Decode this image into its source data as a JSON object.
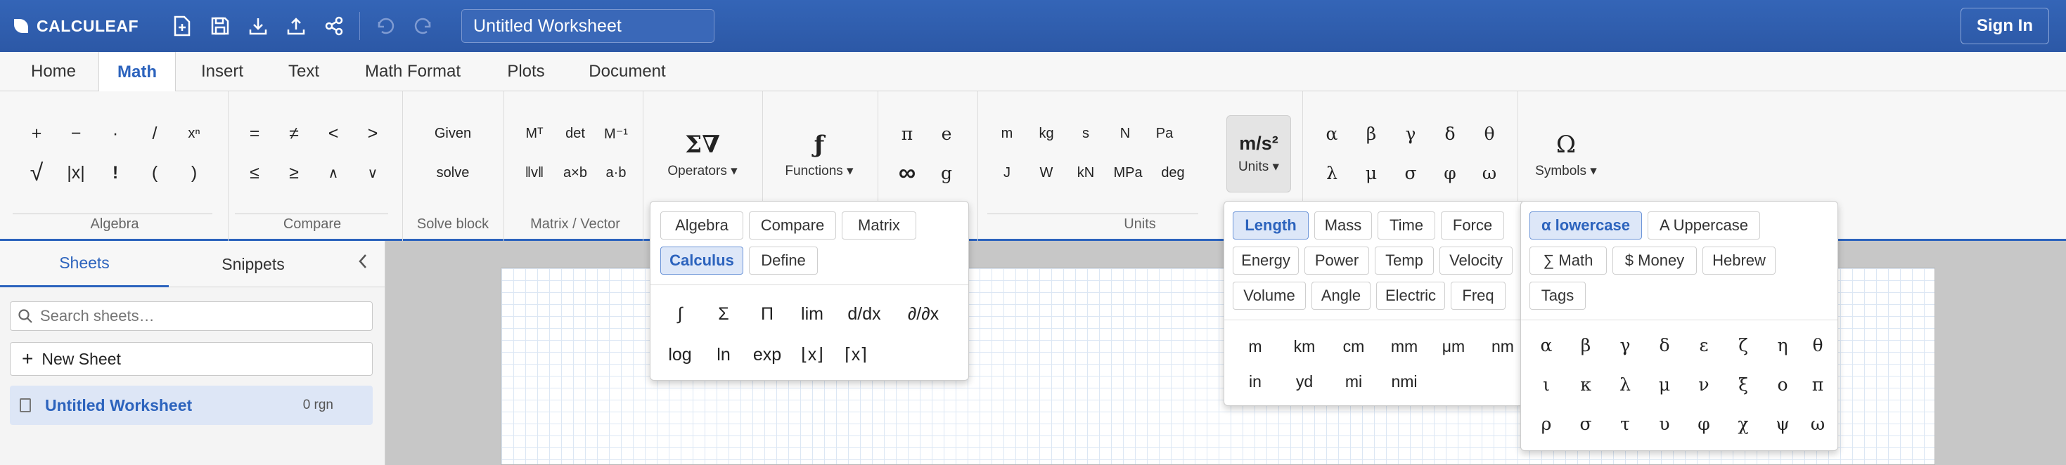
{
  "header": {
    "logo": "CALCULEAF",
    "icons": [
      "new-file-icon",
      "save-icon",
      "download-icon",
      "upload-icon",
      "share-icon",
      "undo-icon",
      "redo-icon"
    ],
    "title_value": "Untitled Worksheet",
    "signin_label": "Sign In"
  },
  "tabs": [
    {
      "label": "Home"
    },
    {
      "label": "Math",
      "active": true
    },
    {
      "label": "Insert"
    },
    {
      "label": "Text"
    },
    {
      "label": "Math Format"
    },
    {
      "label": "Plots"
    },
    {
      "label": "Document"
    }
  ],
  "ribbon": {
    "algebra": {
      "label": "Algebra",
      "items": [
        "+",
        "−",
        "·",
        "/",
        "xⁿ",
        "√",
        "|x|",
        "!",
        "(",
        ")"
      ]
    },
    "compare": {
      "label": "Compare",
      "items": [
        "=",
        "≠",
        "<",
        ">",
        "≤",
        "≥",
        "∧",
        "∨"
      ]
    },
    "solve": {
      "label": "Solve block",
      "items": [
        "Given",
        "solve"
      ]
    },
    "matrix": {
      "label": "Matrix / Vector",
      "items": [
        "Mᵀ",
        "det",
        "M⁻¹",
        "‖v‖",
        "a×b",
        "a·b"
      ]
    },
    "operators": {
      "glyph": "Σ∇",
      "label": "Operators ▾"
    },
    "functions": {
      "glyph": "ƒ",
      "label": "Functions ▾"
    },
    "consts": [
      "π",
      "e",
      "∞",
      "g"
    ],
    "units": {
      "label": "Units",
      "items": [
        "m",
        "kg",
        "s",
        "N",
        "Pa",
        "J",
        "W",
        "kN",
        "MPa",
        "deg"
      ]
    },
    "units_btn": {
      "glyph": "m/s²",
      "label": "Units ▾"
    },
    "greek": [
      "α",
      "β",
      "γ",
      "δ",
      "θ",
      "λ",
      "μ",
      "σ",
      "φ",
      "ω"
    ],
    "symbols_btn": {
      "glyph": "Ω",
      "label": "Symbols ▾"
    }
  },
  "sidebar": {
    "tabs": [
      "Sheets",
      "Snippets"
    ],
    "collapse": "‹",
    "search_placeholder": "Search sheets…",
    "new_sheet": "New Sheet",
    "sheet": {
      "name": "Untitled Worksheet",
      "meta": "0 rgn"
    }
  },
  "operators_dd": {
    "categories": [
      "Algebra",
      "Compare",
      "Matrix",
      "Calculus",
      "Define"
    ],
    "active": "Calculus",
    "items": [
      "∫",
      "Σ",
      "Π",
      "lim",
      "d/dx",
      "∂/∂x",
      "log",
      "ln",
      "exp",
      "⌊x⌋",
      "⌈x⌉"
    ]
  },
  "units_dd": {
    "categories": [
      "Length",
      "Mass",
      "Time",
      "Force",
      "Energy",
      "Power",
      "Temp",
      "Velocity",
      "Volume",
      "Angle",
      "Electric",
      "Freq"
    ],
    "active": "Length",
    "items": [
      "m",
      "km",
      "cm",
      "mm",
      "μm",
      "nm",
      "in",
      "yd",
      "mi",
      "nmi"
    ]
  },
  "symbols_dd": {
    "categories": [
      "α lowercase",
      "A Uppercase",
      "∑ Math",
      "$ Money",
      "Hebrew",
      "Tags"
    ],
    "active": "α lowercase",
    "items": [
      "α",
      "β",
      "γ",
      "δ",
      "ε",
      "ζ",
      "η",
      "θ",
      "ι",
      "κ",
      "λ",
      "μ",
      "ν",
      "ξ",
      "ο",
      "π",
      "ρ",
      "σ",
      "τ",
      "υ",
      "φ",
      "χ",
      "ψ",
      "ω"
    ]
  }
}
